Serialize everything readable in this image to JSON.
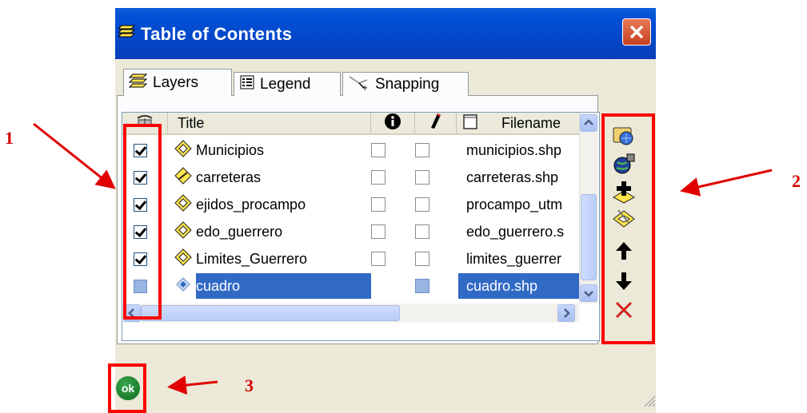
{
  "window": {
    "title": "Table of Contents"
  },
  "tabs": [
    {
      "label": "Layers",
      "icon": "layers-icon"
    },
    {
      "label": "Legend",
      "icon": "legend-icon"
    },
    {
      "label": "Snapping",
      "icon": "snapping-icon"
    }
  ],
  "columns": {
    "title": "Title",
    "filename": "Filename"
  },
  "layers": [
    {
      "title": "Municipios",
      "visible": true,
      "info": false,
      "edit": false,
      "filename": "municipios.shp"
    },
    {
      "title": "carreteras",
      "visible": true,
      "info": false,
      "edit": false,
      "filename": "carreteras.shp"
    },
    {
      "title": "ejidos_procampo",
      "visible": true,
      "info": false,
      "edit": false,
      "filename": "procampo_utm"
    },
    {
      "title": "edo_guerrero",
      "visible": true,
      "info": false,
      "edit": false,
      "filename": "edo_guerrero.s"
    },
    {
      "title": "Limites_Guerrero",
      "visible": true,
      "info": false,
      "edit": false,
      "filename": "limites_guerrer"
    },
    {
      "title": "cuadro",
      "visible": false,
      "info": false,
      "edit": false,
      "filename": "cuadro.shp",
      "selected": true
    }
  ],
  "toolbar": [
    "add-database-layer-icon",
    "add-web-layer-icon",
    "add-layer-icon",
    "layer-properties-icon",
    "move-up-icon",
    "move-down-icon",
    "remove-layer-icon"
  ],
  "ok_button": {
    "label": "ok"
  },
  "annotations": [
    {
      "label": "1"
    },
    {
      "label": "2"
    },
    {
      "label": "3"
    }
  ],
  "colors": {
    "titlebar": "#0350d6",
    "selection": "#316ac5",
    "annotation": "#ff0000"
  }
}
